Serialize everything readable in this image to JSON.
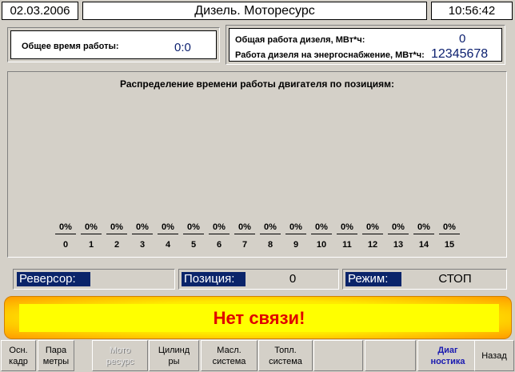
{
  "header": {
    "date": "02.03.2006",
    "title": "Дизель. Моторесурс",
    "time": "10:56:42"
  },
  "work_time": {
    "label": "Общее время работы:",
    "value": "0:0"
  },
  "diesel_work": {
    "total_label": "Общая работа дизеля, МВт*ч:",
    "total_value": "0",
    "energy_label": "Работа дизеля на энергоснабжение, МВт*ч:",
    "energy_value": "12345678"
  },
  "distribution": {
    "title": "Распределение времени работы двигателя по позициям:",
    "positions": [
      {
        "num": "0",
        "pct": "0%"
      },
      {
        "num": "1",
        "pct": "0%"
      },
      {
        "num": "2",
        "pct": "0%"
      },
      {
        "num": "3",
        "pct": "0%"
      },
      {
        "num": "4",
        "pct": "0%"
      },
      {
        "num": "5",
        "pct": "0%"
      },
      {
        "num": "6",
        "pct": "0%"
      },
      {
        "num": "7",
        "pct": "0%"
      },
      {
        "num": "8",
        "pct": "0%"
      },
      {
        "num": "9",
        "pct": "0%"
      },
      {
        "num": "10",
        "pct": "0%"
      },
      {
        "num": "11",
        "pct": "0%"
      },
      {
        "num": "12",
        "pct": "0%"
      },
      {
        "num": "13",
        "pct": "0%"
      },
      {
        "num": "14",
        "pct": "0%"
      },
      {
        "num": "15",
        "pct": "0%"
      }
    ]
  },
  "status": {
    "reverser_label": "Реверсор:",
    "reverser_value": "",
    "position_label": "Позиция:",
    "position_value": "0",
    "mode_label": "Режим:",
    "mode_value": "СТОП"
  },
  "alarm": {
    "text": "Нет связи!",
    "color": "#e00000"
  },
  "nav": [
    {
      "label": "Осн.\nкадр",
      "state": "normal"
    },
    {
      "label": "Пара\nметры",
      "state": "normal"
    },
    {
      "label": "Мото\nресурс",
      "state": "disabled"
    },
    {
      "label": "Цилинд\nры",
      "state": "normal"
    },
    {
      "label": "Масл.\nсистема",
      "state": "normal"
    },
    {
      "label": "Топл.\nсистема",
      "state": "normal"
    },
    {
      "label": "",
      "state": "normal"
    },
    {
      "label": "",
      "state": "normal"
    },
    {
      "label": "Диаг\nностика",
      "state": "active"
    },
    {
      "label": "Назад",
      "state": "normal"
    }
  ]
}
